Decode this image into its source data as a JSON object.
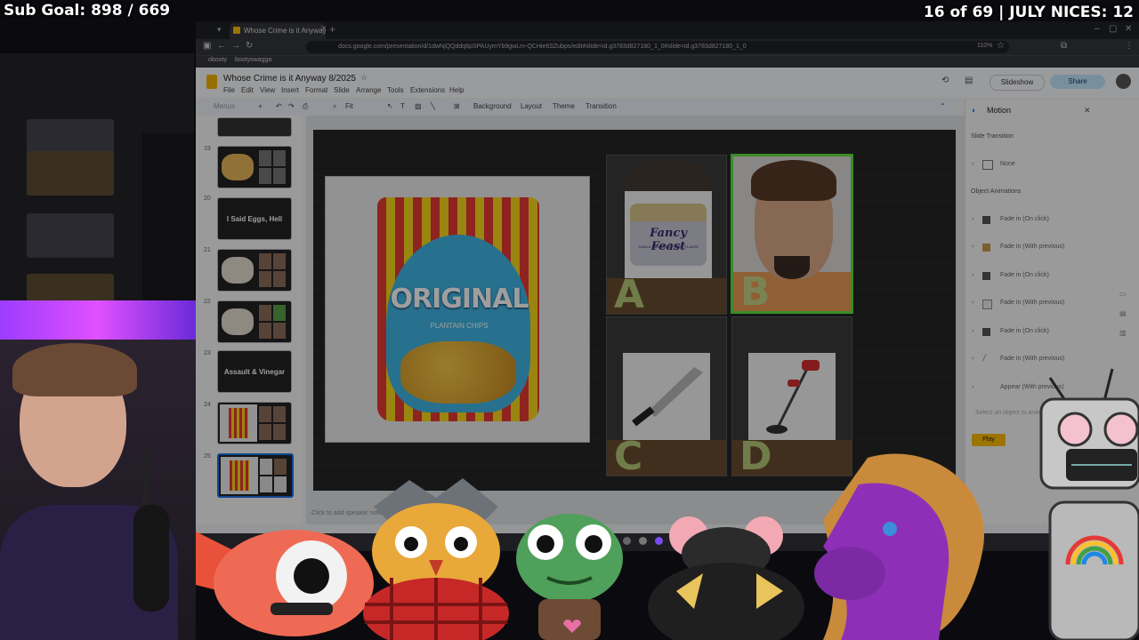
{
  "overlay": {
    "sub_goal": "Sub Goal: 898 / 669",
    "counter": "16 of 69 | JULY NICES: 12"
  },
  "browser": {
    "tab_title": "Whose Crime is it Anyway 8/2025",
    "url": "docs.google.com/presentation/d/1dwNjQQddq6pSPAUymYb9gwLm-QCHie6SZubps/edit#slide=id.g3783d827180_1_0#slide=id.g3783d827180_1_0",
    "zoom": "110%",
    "bookmarks": [
      "obooty",
      "bootyswagga"
    ]
  },
  "slides_app": {
    "doc_title": "Whose Crime is it Anyway 8/2025",
    "menu": [
      "File",
      "Edit",
      "View",
      "Insert",
      "Format",
      "Slide",
      "Arrange",
      "Tools",
      "Extensions",
      "Help"
    ],
    "slideshow_label": "Slideshow",
    "share_label": "Share",
    "toolbar": {
      "menus": "Menus",
      "fit": "Fit",
      "background": "Background",
      "layout": "Layout",
      "theme": "Theme",
      "transition": "Transition"
    },
    "speaker_notes_placeholder": "Click to add speaker notes"
  },
  "filmstrip": {
    "numbers": [
      "19",
      "20",
      "21",
      "22",
      "23",
      "24",
      "25"
    ],
    "text_slides": {
      "s20": "I Said Eggs, Hell",
      "s23": "Assault & Vinegar"
    }
  },
  "slide": {
    "bag_brand": "ORIGINAL",
    "bag_sub": "PLANTAIN CHIPS",
    "suspects": [
      {
        "letter": "A",
        "item": "Fancy Feast",
        "item_sub": "TUNA & MACKEREL FEAST FLAKED"
      },
      {
        "letter": "B",
        "item": ""
      },
      {
        "letter": "C",
        "item": ""
      },
      {
        "letter": "D",
        "item": ""
      }
    ]
  },
  "motion_panel": {
    "title": "Motion",
    "slide_transition_label": "Slide Transition",
    "transition_value": "None",
    "object_animations_label": "Object Animations",
    "animations": [
      "Fade in  (On click)",
      "Fade in  (With previous)",
      "Fade in  (On click)",
      "Fade in  (With previous)",
      "Fade in  (On click)",
      "Fade in  (With previous)",
      "Appear  (With previous)"
    ],
    "play_label": "Play",
    "select_object_hint": "Select an object to animate"
  },
  "colors": {
    "selected_border": "#5ee33c",
    "accent": "#1a73e8",
    "play_button": "#fbbc04"
  }
}
